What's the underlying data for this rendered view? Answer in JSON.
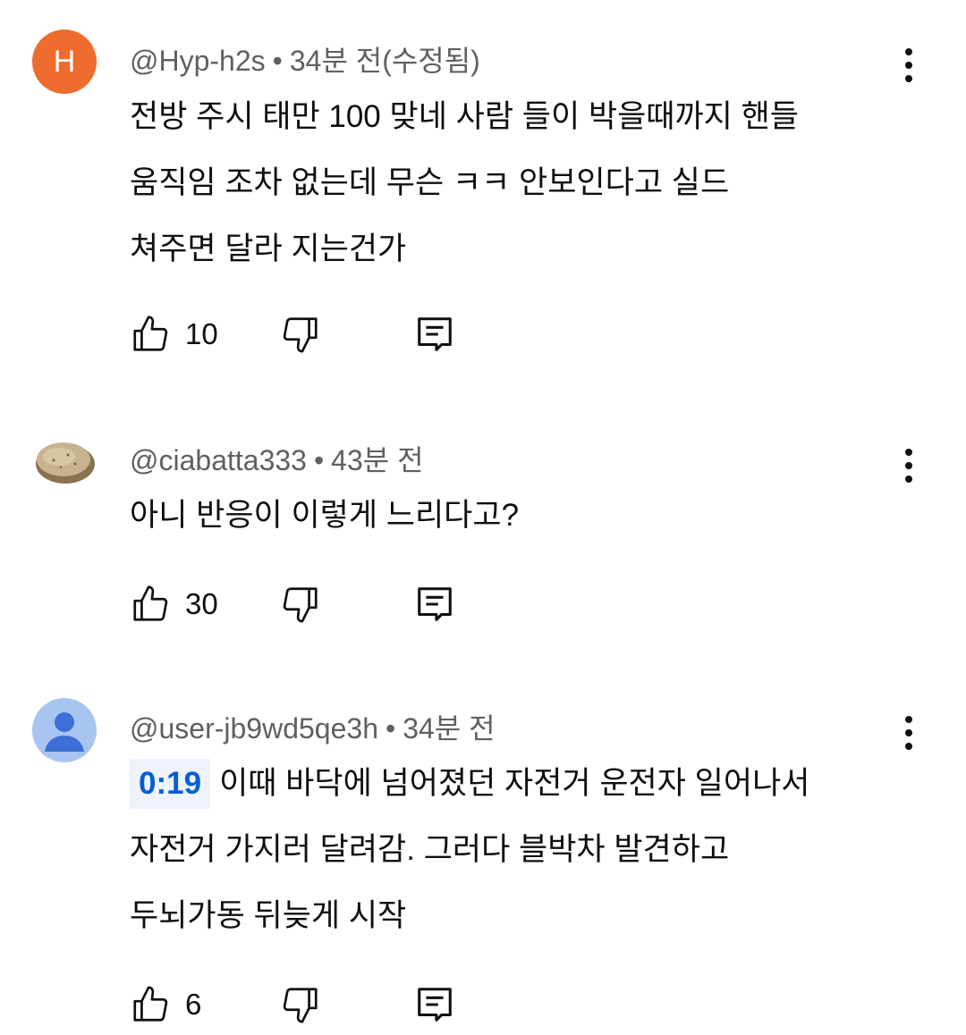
{
  "comments": [
    {
      "author": "@Hyp-h2s",
      "separator": "•",
      "time": "34분 전(수정됨)",
      "avatar_letter": "H",
      "lines": [
        "전방 주시 태만 100 맞네  사람 들이 박을때까지 핸들",
        "움직임 조차 없는데 무슨 ㅋㅋ  안보인다고 실드",
        "쳐주면 달라 지는건가"
      ],
      "likes": "10"
    },
    {
      "author": "@ciabatta333",
      "separator": "•",
      "time": "43분 전",
      "lines": [
        "아니 반응이 이렇게 느리다고?"
      ],
      "likes": "30"
    },
    {
      "author": "@user-jb9wd5qe3h",
      "separator": "•",
      "time": "34분 전",
      "timestamp_link": "0:19",
      "lines": [
        "이때 바닥에 넘어졌던 자전거 운전자 일어나서",
        "자전거 가지러 달려감. 그러다 블박차 발견하고",
        "두뇌가동 뒤늦게 시작"
      ],
      "likes": "6"
    }
  ],
  "colors": {
    "avatar_h": "#ef6c2f",
    "link": "#065fd4",
    "meta": "#606060"
  },
  "icons": [
    "like-icon",
    "dislike-icon",
    "reply-icon",
    "more-options-icon"
  ]
}
